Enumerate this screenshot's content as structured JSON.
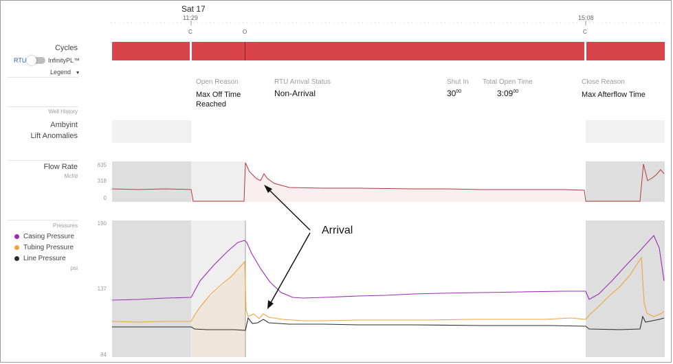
{
  "header": {
    "date_label": "Sat 17",
    "time_start": "11:29",
    "time_end": "15:08",
    "marker_c1": "C",
    "marker_o": "O",
    "marker_c2": "C"
  },
  "sidebar": {
    "cycles_label": "Cycles",
    "rtu_label": "RTU",
    "infinity_label": "InfinityPL™",
    "legend_label": "Legend",
    "well_history_label": "Well History",
    "ambyint_label": "Ambyint",
    "lift_anomalies_label": "Lift Anomalies",
    "flow_rate_label": "Flow Rate",
    "flow_rate_unit": "Mcf/d",
    "pressures_label": "Pressures",
    "casing_label": "Casing Pressure",
    "tubing_label": "Tubing Pressure",
    "line_label": "Line Pressure",
    "pressure_unit": "psi"
  },
  "info": {
    "open_reason_label": "Open Reason",
    "open_reason_line1": "Max Off Time",
    "open_reason_line2": "Reached",
    "rtu_status_label": "RTU Arrival Status",
    "rtu_status_value": "Non-Arrival",
    "shut_in_label": "Shut In",
    "shut_in_main": "30",
    "shut_in_sup": "00",
    "total_open_label": "Total Open Time",
    "total_open_main": "3:09",
    "total_open_sup": "00",
    "close_reason_label": "Close Reason",
    "close_reason_value": "Max Afterflow Time"
  },
  "flow_axis": {
    "top": "635",
    "mid": "318",
    "bottom": "0"
  },
  "pressure_axis": {
    "top": "190",
    "mid": "137",
    "bottom": "84"
  },
  "annotation": {
    "text": "Arrival"
  },
  "colors": {
    "cycle_bar": "#d9434a",
    "flow_line": "#b3363c",
    "casing": "#9b2ab3",
    "tubing": "#f0a23c",
    "line": "#2b2b2b",
    "shade": "#dcdcdc"
  }
}
